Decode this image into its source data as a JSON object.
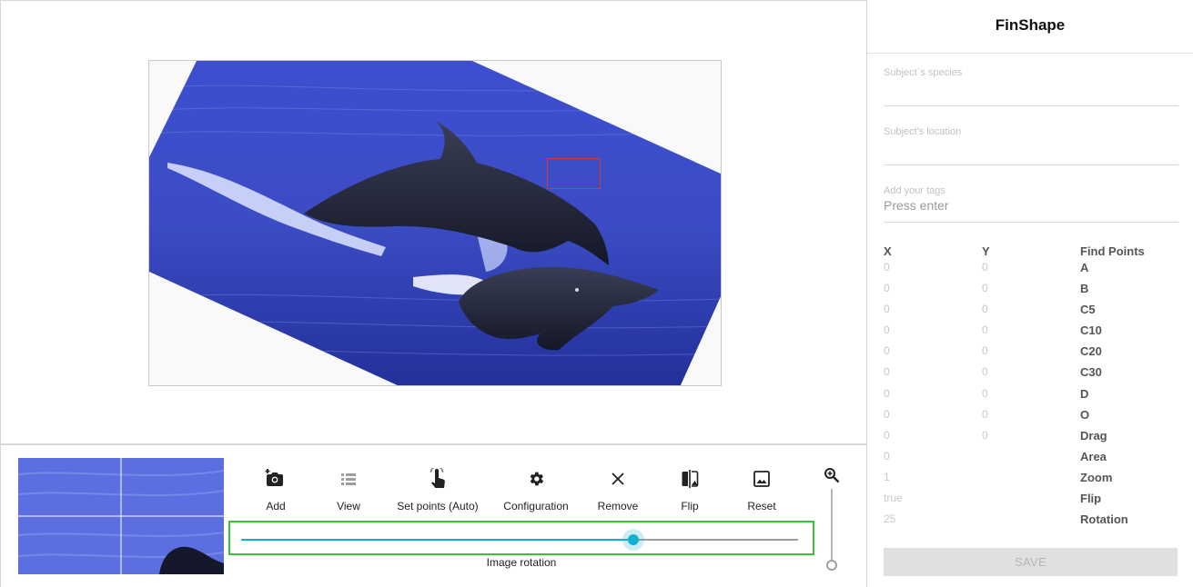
{
  "app": {
    "title": "FinShape"
  },
  "photo": {
    "subject": "two dolphins leaping from blue water",
    "rotation_deg": 25
  },
  "toolbar": {
    "items": [
      {
        "id": "add",
        "label": "Add",
        "icon": "add-photo-icon",
        "enabled": true
      },
      {
        "id": "view",
        "label": "View",
        "icon": "list-icon",
        "enabled": false
      },
      {
        "id": "set_points",
        "label": "Set points (Auto)",
        "icon": "touch-icon",
        "enabled": true
      },
      {
        "id": "configuration",
        "label": "Configuration",
        "icon": "gear-icon",
        "enabled": true
      },
      {
        "id": "remove",
        "label": "Remove",
        "icon": "close-icon",
        "enabled": true
      },
      {
        "id": "flip",
        "label": "Flip",
        "icon": "flip-icon",
        "enabled": true
      },
      {
        "id": "reset",
        "label": "Reset",
        "icon": "image-icon",
        "enabled": true
      }
    ]
  },
  "rotation_slider": {
    "label": "Image rotation",
    "value_fraction": 0.705
  },
  "zoom_slider": {
    "icon": "zoom-in-icon",
    "value_fraction": 0.0
  },
  "form": {
    "species": {
      "label": "Subject`s species",
      "value": ""
    },
    "location": {
      "label": "Subject's location",
      "value": ""
    },
    "tags": {
      "label": "Add your tags",
      "placeholder": "Press enter"
    }
  },
  "points": {
    "headers": {
      "x": "X",
      "y": "Y",
      "name": "Find Points"
    },
    "rows": [
      {
        "x": "0",
        "y": "0",
        "name": "A"
      },
      {
        "x": "0",
        "y": "0",
        "name": "B"
      },
      {
        "x": "0",
        "y": "0",
        "name": "C5"
      },
      {
        "x": "0",
        "y": "0",
        "name": "C10"
      },
      {
        "x": "0",
        "y": "0",
        "name": "C20"
      },
      {
        "x": "0",
        "y": "0",
        "name": "C30"
      },
      {
        "x": "0",
        "y": "0",
        "name": "D"
      },
      {
        "x": "0",
        "y": "0",
        "name": "O"
      },
      {
        "x": "0",
        "y": "0",
        "name": "Drag"
      },
      {
        "x": "0",
        "y": "",
        "name": "Area"
      },
      {
        "x": "1",
        "y": "",
        "name": "Zoom"
      },
      {
        "x": "true",
        "y": "",
        "name": "Flip"
      },
      {
        "x": "25",
        "y": "",
        "name": "Rotation"
      }
    ]
  },
  "save": {
    "label": "SAVE",
    "enabled": false
  },
  "colors": {
    "accent": "#14b0d1",
    "highlight_border": "#37c437",
    "roi_border": "#d23a3a",
    "water": "#3f54cc"
  }
}
